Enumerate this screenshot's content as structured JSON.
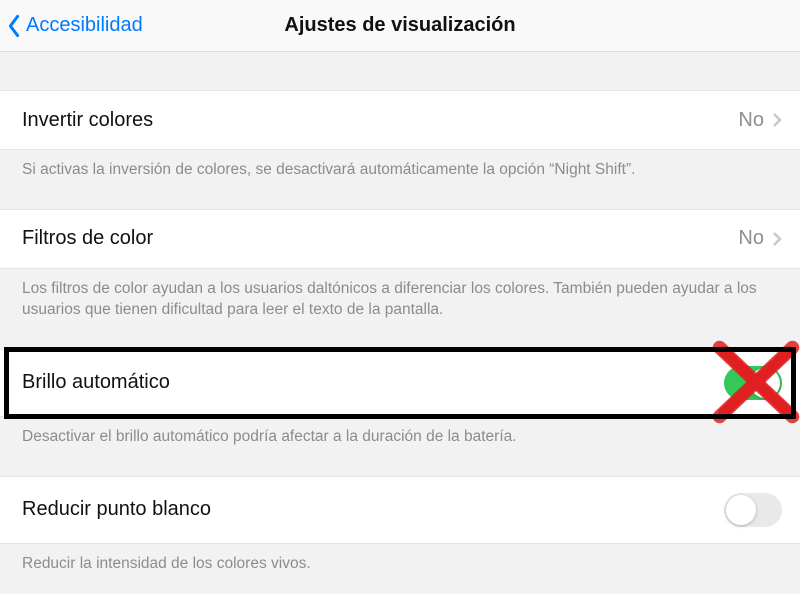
{
  "nav": {
    "back_label": "Accesibilidad",
    "title": "Ajustes de visualización"
  },
  "rows": {
    "invert": {
      "label": "Invertir colores",
      "value": "No",
      "footer": "Si activas la inversión de colores, se desactivará automáticamente la opción “Night Shift”."
    },
    "filters": {
      "label": "Filtros de color",
      "value": "No",
      "footer": "Los filtros de color ayudan a los usuarios daltónicos a diferenciar los colores. También pueden ayudar a los usuarios que tienen dificultad para leer el texto de la pantalla."
    },
    "autobright": {
      "label": "Brillo automático",
      "on": true,
      "footer": "Desactivar el brillo automático podría afectar a la duración de la batería."
    },
    "whitepoint": {
      "label": "Reducir punto blanco",
      "on": false,
      "footer": "Reducir la intensidad de los colores vivos."
    }
  },
  "annotation": {
    "highlight_row": "autobright",
    "red_x_on": "autobright_toggle"
  }
}
